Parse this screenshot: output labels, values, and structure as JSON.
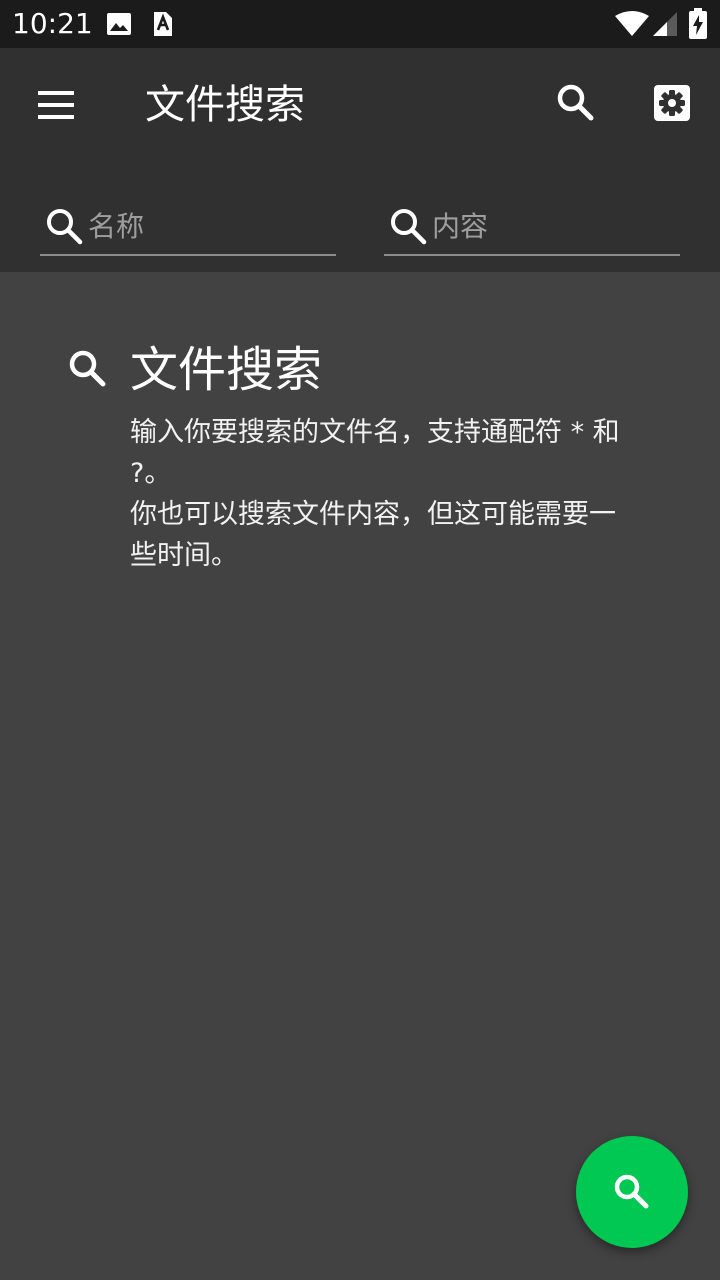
{
  "status_bar": {
    "time": "10:21",
    "icons": [
      "image-icon",
      "a-notification-icon",
      "wifi-icon",
      "cellular-signal-icon",
      "battery-charging-icon"
    ]
  },
  "app_bar": {
    "title": "文件搜索",
    "menu_icon": "hamburger-menu-icon",
    "search_icon": "search-icon",
    "settings_icon": "gear-icon"
  },
  "search": {
    "name_field": {
      "placeholder": "名称",
      "value": ""
    },
    "content_field": {
      "placeholder": "内容",
      "value": ""
    }
  },
  "empty_state": {
    "icon": "search-icon",
    "title": "文件搜索",
    "line1": "输入你要搜索的文件名，支持通配符 * 和 ?。",
    "line2": "你也可以搜索文件内容，但这可能需要一些时间。"
  },
  "fab": {
    "icon": "search-icon",
    "color": "#00c853"
  },
  "colors": {
    "status_bar": "#1b1b1b",
    "app_bar": "#303030",
    "background": "#424242",
    "accent": "#00c853"
  }
}
